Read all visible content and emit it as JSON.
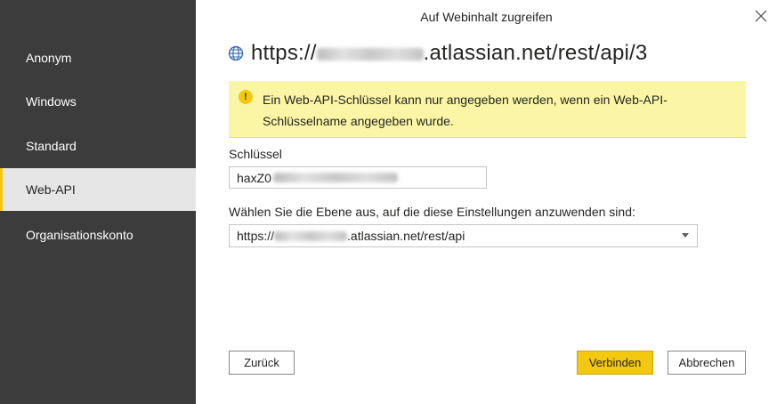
{
  "dialog": {
    "title": "Auf Webinhalt zugreifen",
    "close_icon": "close-icon"
  },
  "sidebar": {
    "items": [
      {
        "label": "Anonym",
        "active": false
      },
      {
        "label": "Windows",
        "active": false
      },
      {
        "label": "Standard",
        "active": false
      },
      {
        "label": "Web-API",
        "active": true
      },
      {
        "label": "Organisationskonto",
        "active": false
      }
    ]
  },
  "url": {
    "prefix": "https://",
    "suffix": ".atlassian.net/rest/api/3",
    "icon": "globe-icon"
  },
  "warning": {
    "icon": "warning-icon",
    "text": "Ein Web-API-Schlüssel kann nur angegeben werden, wenn ein Web-API-Schlüsselname angegeben wurde."
  },
  "key_field": {
    "label": "Schlüssel",
    "value_prefix": "haxZ0"
  },
  "level": {
    "label": "Wählen Sie die Ebene aus, auf die diese Einstellungen anzuwenden sind:",
    "value_prefix": "https://",
    "value_suffix": ".atlassian.net/rest/api"
  },
  "buttons": {
    "back": "Zurück",
    "connect": "Verbinden",
    "cancel": "Abbrechen"
  },
  "colors": {
    "sidebar_bg": "#3c3c3c",
    "accent": "#f2c811",
    "warning_bg": "#fbf6a5",
    "active_item_bg": "#e6e6e6"
  }
}
